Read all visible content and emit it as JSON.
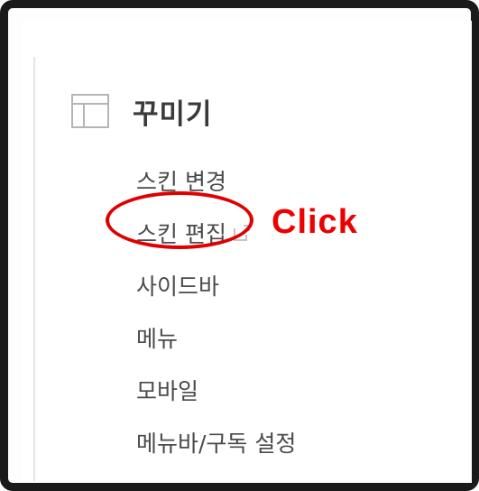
{
  "section": {
    "icon": "layout-icon",
    "title": "꾸미기"
  },
  "menu": {
    "items": [
      {
        "label": "스킨 변경"
      },
      {
        "label": "스킨 편집",
        "icon": "external-link-icon"
      },
      {
        "label": "사이드바"
      },
      {
        "label": "메뉴"
      },
      {
        "label": "모바일"
      },
      {
        "label": "메뉴바/구독 설정"
      }
    ]
  },
  "annotation": {
    "text": "Click",
    "color": "#ee0000"
  },
  "colors": {
    "text": "#4a4a4a",
    "heading": "#3a3a3a",
    "annotation": "#e00000"
  }
}
